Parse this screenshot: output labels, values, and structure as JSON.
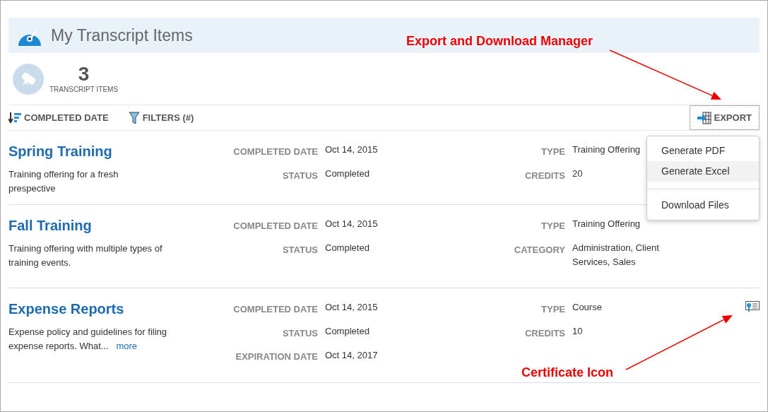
{
  "header": {
    "title": "My Transcript Items"
  },
  "summary": {
    "count": "3",
    "label": "TRANSCRIPT ITEMS"
  },
  "toolbar": {
    "sort": "COMPLETED DATE",
    "filters": "FILTERS (#)",
    "export": "EXPORT"
  },
  "export_menu": [
    {
      "label": "Generate PDF",
      "selected": false,
      "kind": "item"
    },
    {
      "label": "Generate Excel",
      "selected": true,
      "kind": "item"
    },
    {
      "kind": "divider"
    },
    {
      "label": "Download Files",
      "selected": false,
      "kind": "item"
    }
  ],
  "items": [
    {
      "title": "Spring Training",
      "description": "Training offering for a fresh prespective",
      "left": [
        {
          "label": "COMPLETED DATE",
          "value": "Oct 14, 2015"
        },
        {
          "label": "STATUS",
          "value": "Completed"
        }
      ],
      "right": [
        {
          "label": "TYPE",
          "value": "Training Offering"
        },
        {
          "label": "CREDITS",
          "value": "20"
        }
      ]
    },
    {
      "title": "Fall Training",
      "description": "Training offering with multiple types of training events.",
      "certificate": false,
      "left": [
        {
          "label": "COMPLETED DATE",
          "value": "Oct 14, 2015"
        },
        {
          "label": "STATUS",
          "value": "Completed"
        }
      ],
      "right": [
        {
          "label": "TYPE",
          "value": "Training Offering"
        },
        {
          "label": "CATEGORY",
          "value": "Administration, Client Services, Sales"
        }
      ]
    },
    {
      "title": "Expense Reports",
      "description": "Expense policy and guidelines for filing expense reports. What...",
      "more": "more",
      "certificate": true,
      "left": [
        {
          "label": "COMPLETED DATE",
          "value": "Oct 14, 2015"
        },
        {
          "label": "STATUS",
          "value": "Completed"
        },
        {
          "label": "EXPIRATION DATE",
          "value": "Oct 14, 2017"
        }
      ],
      "right": [
        {
          "label": "TYPE",
          "value": "Course"
        },
        {
          "label": "CREDITS",
          "value": "10"
        }
      ]
    }
  ],
  "annotations": [
    {
      "text": "Export and Download Manager"
    },
    {
      "text": "Certificate Icon"
    }
  ]
}
